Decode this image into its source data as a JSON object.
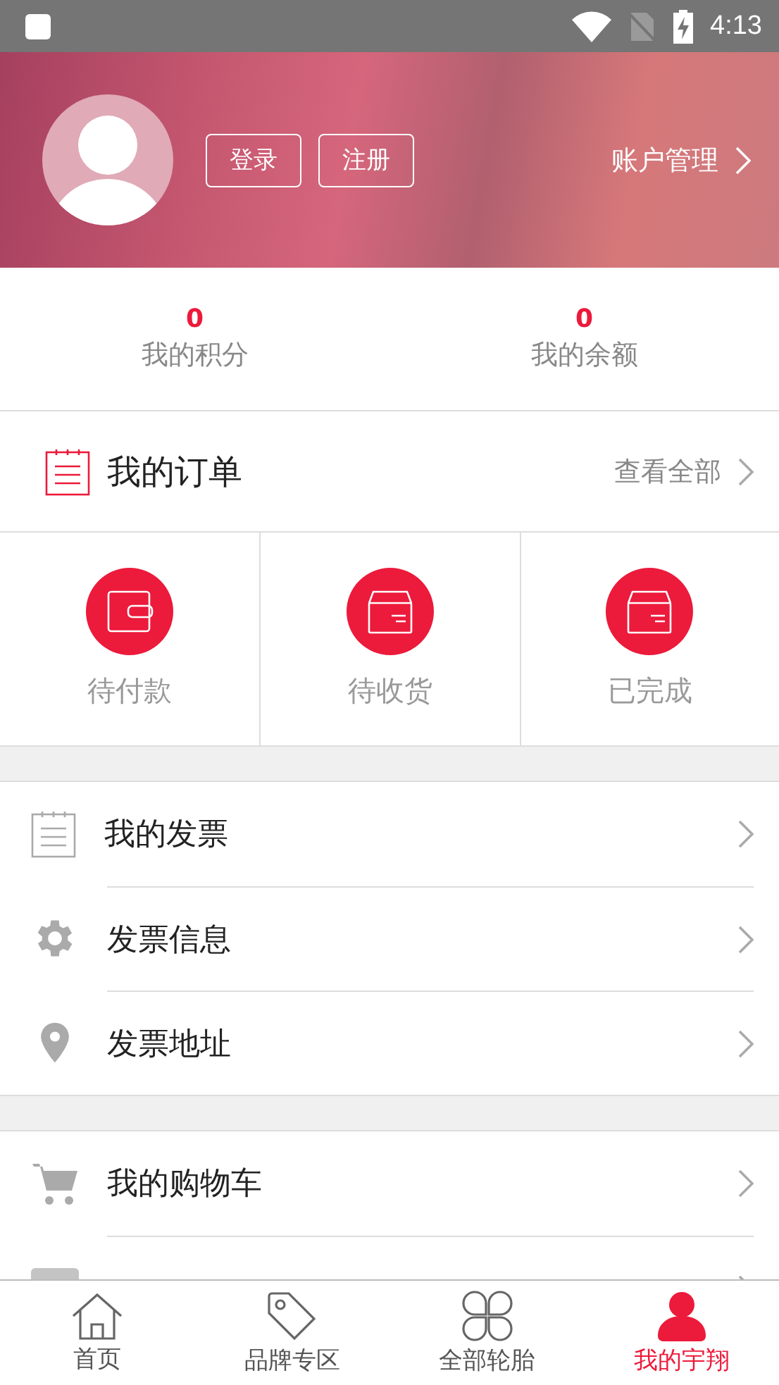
{
  "status_bar": {
    "time": "4:13"
  },
  "header": {
    "buttons": [
      "登录",
      "注册"
    ],
    "account_link": "账户管理"
  },
  "stats": [
    {
      "value": "0",
      "label": "我的积分"
    },
    {
      "value": "0",
      "label": "我的余额"
    }
  ],
  "orders": {
    "title": "我的订单",
    "view_all": "查看全部",
    "items": [
      {
        "kind": "wallet",
        "label": "待付款"
      },
      {
        "kind": "box",
        "label": "待收货"
      },
      {
        "kind": "box",
        "label": "已完成"
      }
    ]
  },
  "menu_groups": [
    [
      {
        "kind": "invoice",
        "label": "我的发票"
      },
      {
        "kind": "gear",
        "label": "发票信息"
      },
      {
        "kind": "pin",
        "label": "发票地址"
      }
    ],
    [
      {
        "kind": "cart",
        "label": "我的购物车"
      },
      {
        "kind": "card"
      }
    ]
  ],
  "bottom_nav": [
    {
      "kind": "home",
      "label": "首页",
      "selected": false
    },
    {
      "kind": "tag",
      "label": "品牌专区",
      "selected": false
    },
    {
      "kind": "clover",
      "label": "全部轮胎",
      "selected": false
    },
    {
      "kind": "person",
      "label": "我的宇翔",
      "selected": true
    }
  ]
}
